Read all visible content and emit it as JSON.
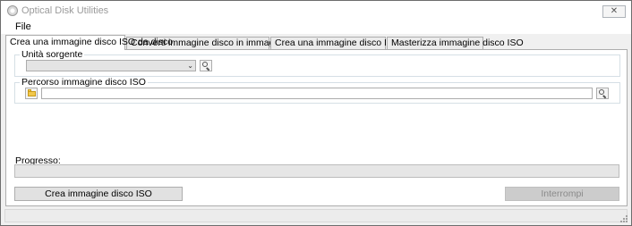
{
  "window": {
    "title": "Optical Disk Utilities",
    "close_glyph": "✕"
  },
  "menu": {
    "file": "File"
  },
  "tabs": [
    {
      "label": "Crea una immagine disco ISO da disco",
      "active": true
    },
    {
      "label": "Converti immagine disco in immagine disco ISO",
      "active": false
    },
    {
      "label": "Crea una immagine disco ISO da files",
      "active": false
    },
    {
      "label": "Masterizza immagine disco ISO",
      "active": false
    }
  ],
  "source_group": {
    "label": "Unità sorgente",
    "selected_value": "",
    "arrow_glyph": "⌄"
  },
  "iso_path_group": {
    "label": "Percorso immagine disco ISO",
    "value": ""
  },
  "progress": {
    "label": "Progresso:",
    "value": 0
  },
  "buttons": {
    "create": "Crea immagine disco ISO",
    "stop": "Interrompi"
  },
  "icons": {
    "app": "disc-icon",
    "source_search": "search-icon",
    "browse": "folder-icon",
    "path_search": "search-icon",
    "grip": "resize-grip-icon"
  }
}
